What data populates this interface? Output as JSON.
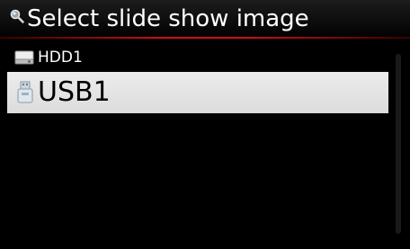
{
  "header": {
    "title": "Select slide show image",
    "icon": "search-icon"
  },
  "list": {
    "items": [
      {
        "label": "HDD1",
        "icon": "hard-drive-icon",
        "selected": false
      },
      {
        "label": "USB1",
        "icon": "usb-drive-icon",
        "selected": true
      }
    ]
  },
  "colors": {
    "background": "#000000",
    "title_rule": "#d01010",
    "selection": "#e4e4e4"
  }
}
